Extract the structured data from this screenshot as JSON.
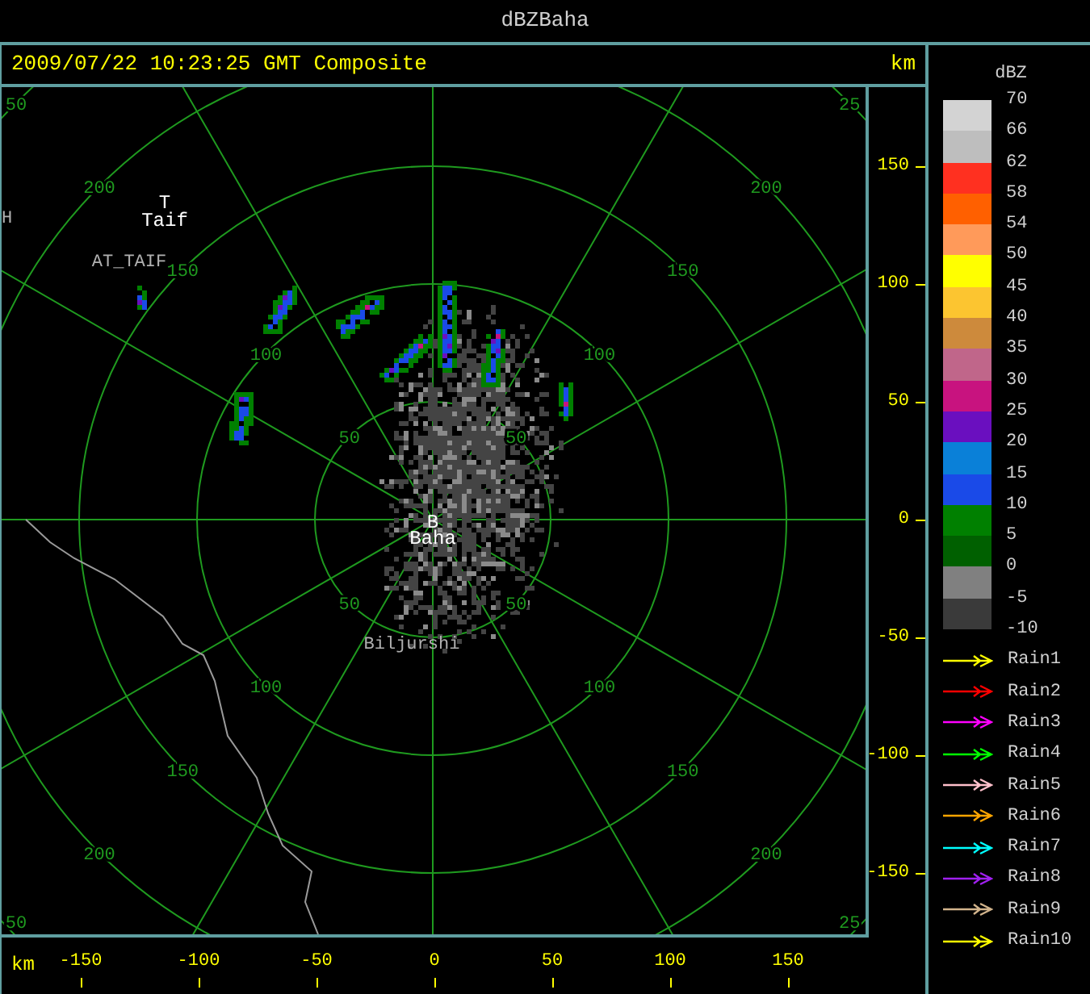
{
  "window": {
    "title": "dBZBaha"
  },
  "header": {
    "timestamp": "2009/07/22 10:23:25 GMT Composite",
    "unit": "km"
  },
  "map": {
    "ring_labels": [
      [
        "50",
        "50",
        "50",
        "50"
      ],
      [
        "100",
        "100",
        "100",
        "100"
      ],
      [
        "150",
        "150",
        "150",
        "150"
      ],
      [
        "200",
        "200",
        "200",
        "200"
      ],
      [
        "50",
        "25",
        "50",
        "25"
      ]
    ],
    "places": [
      {
        "marker": "T",
        "name": "Taif"
      },
      {
        "marker": "B",
        "name": "Baha"
      }
    ],
    "labels": [
      "AT_TAIF",
      "Biljurshi",
      "H"
    ]
  },
  "y_axis": {
    "ticks": [
      "150",
      "100",
      "50",
      "0",
      "-50",
      "-100",
      "-150"
    ]
  },
  "x_axis": {
    "unit": "km",
    "ticks": [
      "-150",
      "-100",
      "-50",
      "0",
      "50",
      "100",
      "150"
    ]
  },
  "legend": {
    "title": "dBZ",
    "scale_labels": [
      "70",
      "66",
      "62",
      "58",
      "54",
      "50",
      "45",
      "40",
      "35",
      "30",
      "25",
      "20",
      "15",
      "10",
      "5",
      "0",
      "-5",
      "-10"
    ],
    "bands": [
      {
        "color": "#d3d3d3"
      },
      {
        "color": "#bebebe"
      },
      {
        "color": "#ff3020"
      },
      {
        "color": "#ff6000"
      },
      {
        "color": "#ff9a5a"
      },
      {
        "color": "#ffff00"
      },
      {
        "color": "#fcc530"
      },
      {
        "color": "#cd8a3c"
      },
      {
        "color": "#c0668a"
      },
      {
        "color": "#c8137f"
      },
      {
        "color": "#6a0fbf"
      },
      {
        "color": "#0a80d8"
      },
      {
        "color": "#1a4ae8"
      },
      {
        "color": "#008000"
      },
      {
        "color": "#006000"
      },
      {
        "color": "#808080"
      },
      {
        "color": "#3a3a3a"
      }
    ],
    "tracks": [
      {
        "label": "Rain1",
        "color": "#ffff00"
      },
      {
        "label": "Rain2",
        "color": "#ff0000"
      },
      {
        "label": "Rain3",
        "color": "#ff00ff"
      },
      {
        "label": "Rain4",
        "color": "#00ff00"
      },
      {
        "label": "Rain5",
        "color": "#ffc0cb"
      },
      {
        "label": "Rain6",
        "color": "#ffa500"
      },
      {
        "label": "Rain7",
        "color": "#00ffff"
      },
      {
        "label": "Rain8",
        "color": "#a020f0"
      },
      {
        "label": "Rain9",
        "color": "#d2b48c"
      },
      {
        "label": "Rain10",
        "color": "#ffff00"
      }
    ]
  }
}
